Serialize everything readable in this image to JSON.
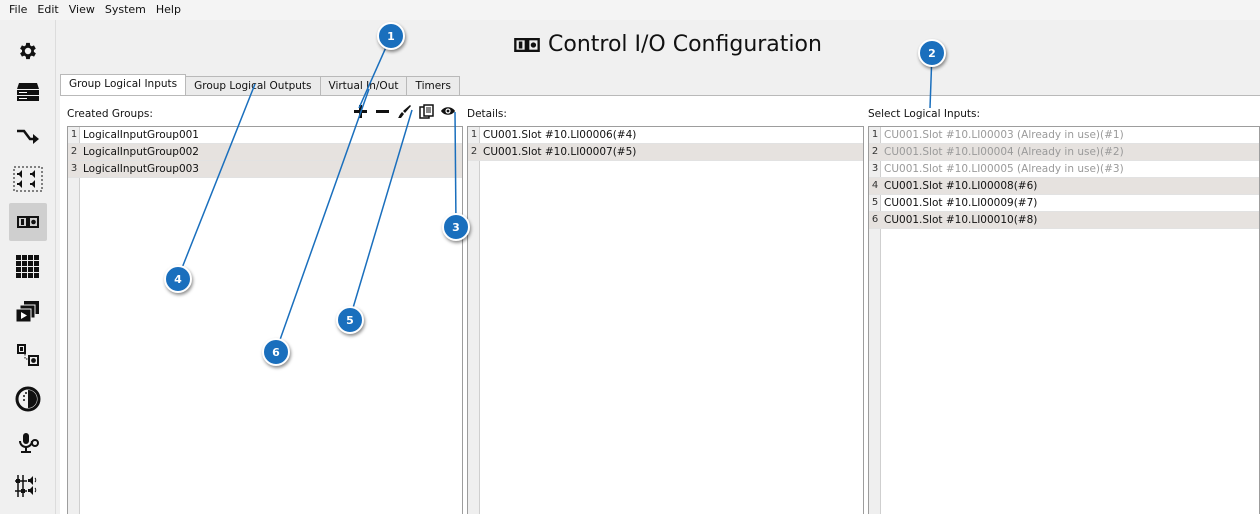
{
  "menu": [
    "File",
    "Edit",
    "View",
    "System",
    "Help"
  ],
  "title": "Control I/O Configuration",
  "sidebar_icons": [
    "gear-icon",
    "server-rack-icon",
    "routing-arrow-icon",
    "audio-channels-icon",
    "control-io-icon",
    "matrix-grid-icon",
    "video-slides-icon",
    "io-mapping-icon",
    "meter-clock-icon",
    "microphone-settings-icon",
    "fader-speaker-icon"
  ],
  "tabs": [
    {
      "label": "Group Logical Inputs",
      "active": true
    },
    {
      "label": "Group Logical Outputs",
      "active": false
    },
    {
      "label": "Virtual In/Out",
      "active": false
    },
    {
      "label": "Timers",
      "active": false
    }
  ],
  "labels": {
    "created_groups": "Created Groups:",
    "details": "Details:",
    "select_logical_inputs": "Select Logical Inputs:"
  },
  "toolbar": [
    "add-icon",
    "remove-icon",
    "rename-brush-icon",
    "copy-icon",
    "view-icon"
  ],
  "groups": [
    {
      "idx": "1",
      "name": "LogicalInputGroup001"
    },
    {
      "idx": "2",
      "name": "LogicalInputGroup002"
    },
    {
      "idx": "3",
      "name": "LogicalInputGroup003"
    }
  ],
  "details": [
    {
      "idx": "1",
      "name": "CU001.Slot #10.LI00006(#4)"
    },
    {
      "idx": "2",
      "name": "CU001.Slot #10.LI00007(#5)"
    }
  ],
  "logical_inputs": [
    {
      "idx": "1",
      "name": "CU001.Slot #10.LI00003 (Already in use)(#1)",
      "disabled": true
    },
    {
      "idx": "2",
      "name": "CU001.Slot #10.LI00004 (Already in use)(#2)",
      "disabled": true
    },
    {
      "idx": "3",
      "name": "CU001.Slot #10.LI00005 (Already in use)(#3)",
      "disabled": true
    },
    {
      "idx": "4",
      "name": "CU001.Slot #10.LI00008(#6)",
      "disabled": false
    },
    {
      "idx": "5",
      "name": "CU001.Slot #10.LI00009(#7)",
      "disabled": false
    },
    {
      "idx": "6",
      "name": "CU001.Slot #10.LI00010(#8)",
      "disabled": false
    }
  ],
  "callouts": [
    "1",
    "2",
    "3",
    "4",
    "5",
    "6"
  ],
  "colors": {
    "badge": "#1a6fbd",
    "row_alt": "#e6e2df",
    "disabled_text": "#9a9a9a"
  }
}
